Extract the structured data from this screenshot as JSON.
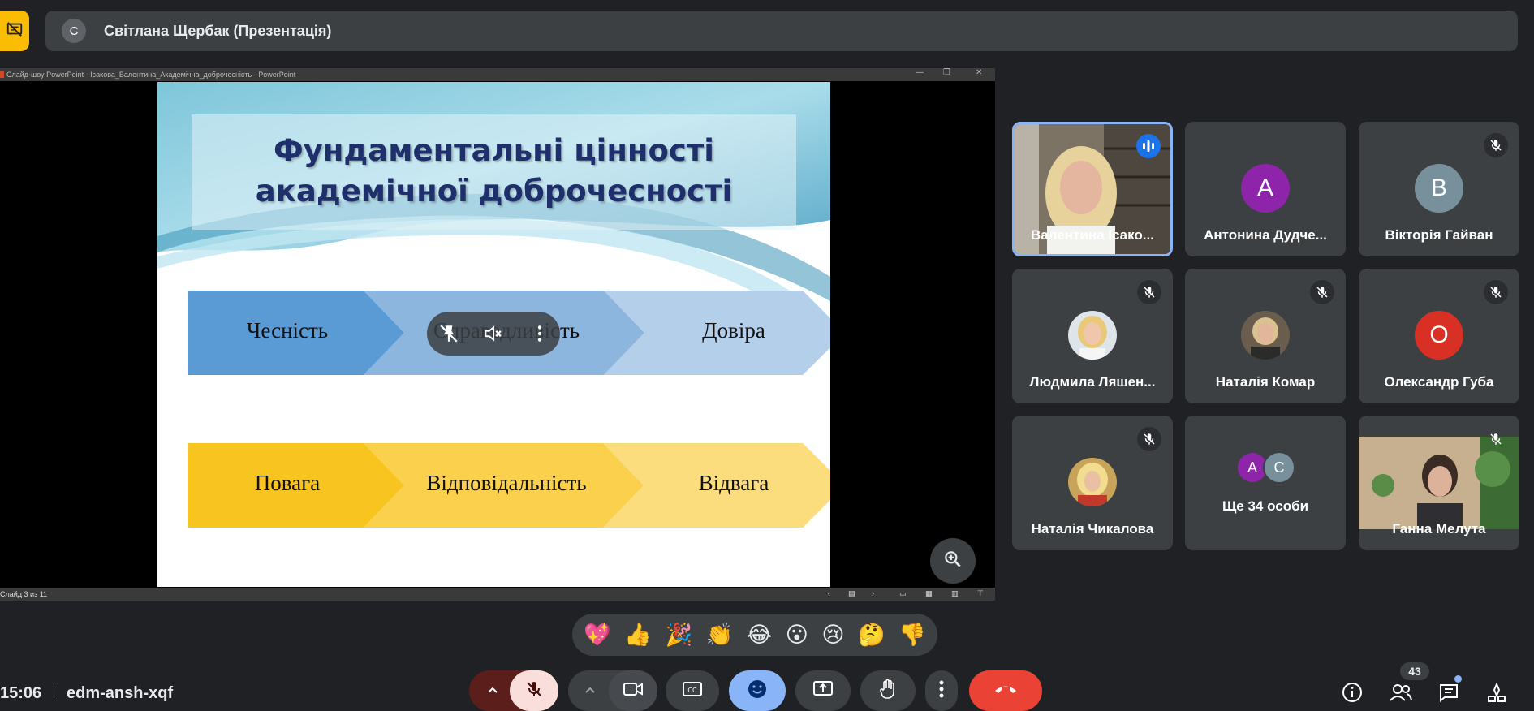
{
  "top_bar": {
    "presenter_avatar_letter": "С",
    "presenter_label": "Світлана Щербак (Презентація)"
  },
  "ppt_window": {
    "title": "Слайд-шоу PowerPoint  -  Ісакова_Валентина_Академічна_доброчесність  -  PowerPoint",
    "status": "Слайд 3 из 11"
  },
  "slide": {
    "title_line1": "Фундаментальні цінності",
    "title_line2": "академічної доброчесності",
    "row1": [
      "Чесність",
      "Справедливість",
      "Довіра"
    ],
    "row2": [
      "Повага",
      "Відповідальність",
      "Відвага"
    ]
  },
  "participants": [
    {
      "name": "Валентина Ісако...",
      "type": "video",
      "speaking": true
    },
    {
      "name": "Антонина Дудче...",
      "type": "letter",
      "letter": "А",
      "color": "#8e24aa"
    },
    {
      "name": "Вікторія Гайван",
      "type": "letter",
      "letter": "В",
      "color": "#78909c",
      "muted": true
    },
    {
      "name": "Людмила Ляшен...",
      "type": "photo",
      "muted": true
    },
    {
      "name": "Наталія Комар",
      "type": "photo",
      "muted": true
    },
    {
      "name": "Олександр Губа",
      "type": "letter",
      "letter": "О",
      "color": "#d93025",
      "muted": true
    },
    {
      "name": "Наталія Чикалова",
      "type": "photo",
      "muted": true
    },
    {
      "name": "Ще 34 особи",
      "type": "more",
      "letters": [
        "А",
        "С"
      ]
    },
    {
      "name": "Ганна Мелута",
      "type": "video",
      "muted": true
    }
  ],
  "reactions": [
    "💖",
    "👍",
    "🎉",
    "👏",
    "😂",
    "😮",
    "😢",
    "🤔",
    "👎"
  ],
  "bottom_bar": {
    "time": "15:06",
    "meeting_code": "edm-ansh-xqf",
    "participant_count": "43"
  },
  "colors": {
    "background": "#202124",
    "tile": "#3c4043",
    "present_accent": "#fbbc04",
    "end_call": "#ea4335",
    "active_speaker_border": "#8ab4f8"
  }
}
